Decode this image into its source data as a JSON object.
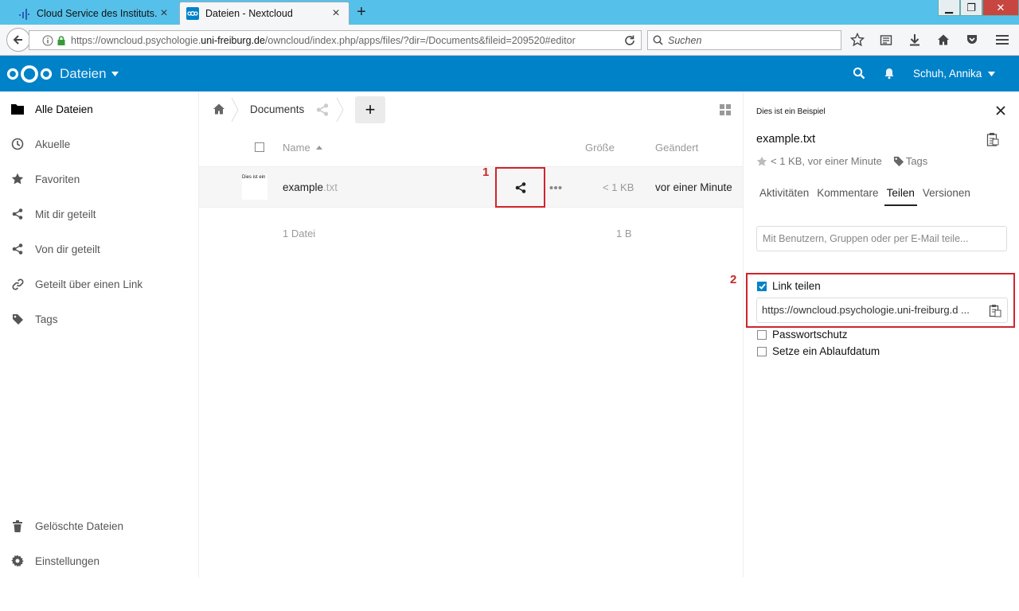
{
  "browser": {
    "tabs": [
      {
        "title": "Cloud Service des Instituts...",
        "active": false
      },
      {
        "title": "Dateien - Nextcloud",
        "active": true
      }
    ],
    "url_prefix": "https://owncloud.psychologie.",
    "url_domain": "uni-freiburg.de",
    "url_suffix": "/owncloud/index.php/apps/files/?dir=/Documents&fileid=209520#editor",
    "search_placeholder": "Suchen"
  },
  "header": {
    "app_name": "Dateien",
    "user_name": "Schuh, Annika",
    "brand_color": "#0082c9"
  },
  "sidebar_nav": {
    "items": [
      {
        "label": "Alle Dateien",
        "icon": "folder-icon",
        "active": true
      },
      {
        "label": "Akuelle",
        "icon": "clock-icon"
      },
      {
        "label": "Favoriten",
        "icon": "star-icon"
      },
      {
        "label": "Mit dir geteilt",
        "icon": "share-icon"
      },
      {
        "label": "Von dir geteilt",
        "icon": "share-icon"
      },
      {
        "label": "Geteilt über einen Link",
        "icon": "link-icon"
      },
      {
        "label": "Tags",
        "icon": "tag-icon"
      }
    ],
    "bottom": [
      {
        "label": "Gelöschte Dateien",
        "icon": "trash-icon"
      },
      {
        "label": "Einstellungen",
        "icon": "gear-icon"
      }
    ]
  },
  "files": {
    "breadcrumb": "Documents",
    "columns": {
      "name": "Name",
      "size": "Größe",
      "modified": "Geändert"
    },
    "rows": [
      {
        "thumb_text": "Dies ist ein",
        "name": "example",
        "ext": ".txt",
        "size": "< 1 KB",
        "modified": "vor einer Minute"
      }
    ],
    "summary": {
      "count": "1 Datei",
      "size": "1 B"
    }
  },
  "annotations": [
    "1",
    "2"
  ],
  "details": {
    "preview_text": "Dies ist ein Beispiel",
    "file_name": "example.txt",
    "meta": "< 1 KB, vor einer Minute",
    "tags_label": "Tags",
    "tabs": [
      "Aktivitäten",
      "Kommentare",
      "Teilen",
      "Versionen"
    ],
    "active_tab": "Teilen",
    "share_placeholder": "Mit Benutzern, Gruppen oder per E-Mail teile...",
    "link_share_label": "Link teilen",
    "link_share_checked": true,
    "link_url": "https://owncloud.psychologie.uni-freiburg.d ...",
    "password_label": "Passwortschutz",
    "expiry_label": "Setze ein Ablaufdatum"
  }
}
